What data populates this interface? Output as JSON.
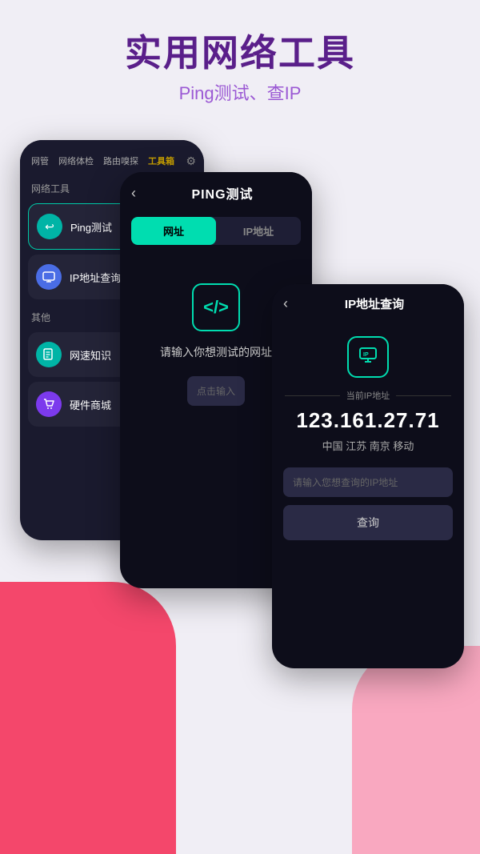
{
  "header": {
    "title": "实用网络工具",
    "subtitle": "Ping测试、查IP"
  },
  "phone_left": {
    "nav_tabs": [
      "网管",
      "网络体检",
      "路由嗅探",
      "工具箱"
    ],
    "active_tab": "工具箱",
    "section_network": "网络工具",
    "section_other": "其他",
    "tools_network": [
      {
        "label": "Ping测试",
        "icon": "↩",
        "icon_class": "teal",
        "highlighted": true
      },
      {
        "label": "IP地址查询",
        "icon": "🖥",
        "icon_class": "blue",
        "highlighted": false
      }
    ],
    "tools_other": [
      {
        "label": "网速知识",
        "icon": "📖",
        "icon_class": "teal",
        "highlighted": false
      },
      {
        "label": "硬件商城",
        "icon": "🛒",
        "icon_class": "purple",
        "highlighted": false
      }
    ]
  },
  "phone_mid": {
    "title": "PING测试",
    "tabs": [
      "网址",
      "IP地址"
    ],
    "active_tab": "网址",
    "hint": "请输入你想测试的网址",
    "input_placeholder": "点击输入"
  },
  "phone_right": {
    "title": "IP地址查询",
    "divider_label": "当前IP地址",
    "ip_address": "123.161.27.71",
    "ip_location": "中国 江苏 南京 移动",
    "input_placeholder": "请输入您想查询的IP地址",
    "query_button": "查询"
  },
  "icons": {
    "back": "‹",
    "chevron_right": "›",
    "gear": "⚙"
  }
}
